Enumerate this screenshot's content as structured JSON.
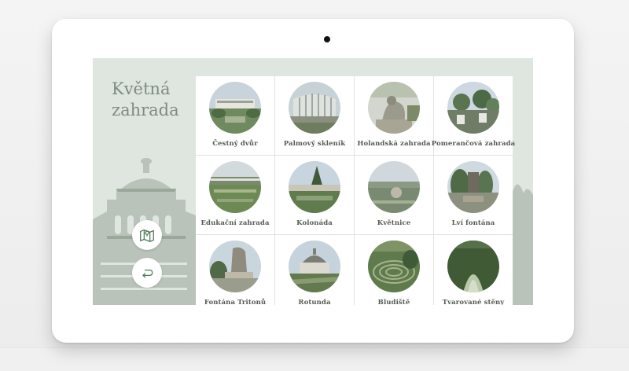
{
  "page": {
    "title": "Květná zahrada"
  },
  "title_lines": [
    "Květná",
    "zahrada"
  ],
  "side_buttons": {
    "map_icon": "map-pin-icon",
    "back_icon": "return-arrow-icon"
  },
  "colors": {
    "screen_bg": "#dfe5df",
    "accent": "#4f7a5c",
    "title": "#7f8c7f"
  },
  "tiles": [
    {
      "label": "Čestný dvůr",
      "icon": "photo-cestny-dvur"
    },
    {
      "label": "Palmový skleník",
      "icon": "photo-palmovy-sklenik"
    },
    {
      "label": "Holandská zahrada",
      "icon": "photo-holandska-zahrada"
    },
    {
      "label": "Pomerančová zahrada",
      "icon": "photo-pomerancova-zahrada"
    },
    {
      "label": "Edukační zahrada",
      "icon": "photo-edukacni-zahrada"
    },
    {
      "label": "Kolonáda",
      "icon": "photo-kolonada"
    },
    {
      "label": "Květnice",
      "icon": "photo-kvetnice"
    },
    {
      "label": "Lví fontána",
      "icon": "photo-lvi-fontana"
    },
    {
      "label": "Fontána Tritonů",
      "icon": "photo-fontana-tritonu"
    },
    {
      "label": "Rotunda",
      "icon": "photo-rotunda"
    },
    {
      "label": "Bludiště",
      "icon": "photo-bludiste"
    },
    {
      "label": "Tvarované stěny",
      "icon": "photo-tvarovane-steny"
    }
  ]
}
